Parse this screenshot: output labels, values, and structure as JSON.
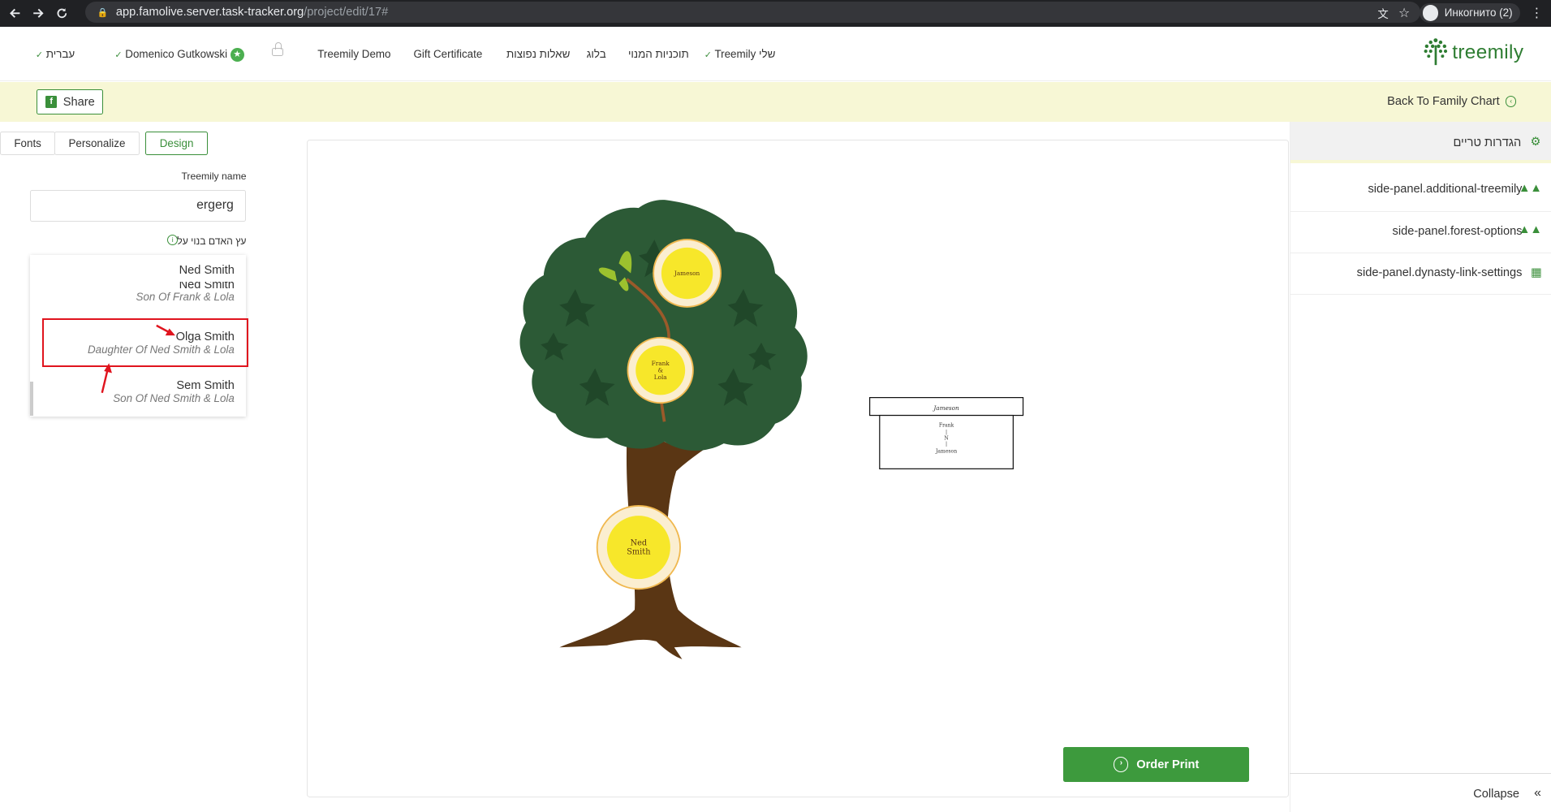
{
  "browser": {
    "url_host": "app.famolive.server.task-tracker.org",
    "url_path": "/project/edit/17#",
    "profile": "Инкогнито (2)"
  },
  "header": {
    "language": "עברית",
    "user": "Domenico Gutkowski",
    "nav": [
      "Treemily Demo",
      "Gift Certificate",
      "שאלות נפוצות",
      "בלוג",
      "תוכניות המנוי",
      "Treemily שלי"
    ],
    "logo": "treemily"
  },
  "toolbar": {
    "share": "Share",
    "back": "Back To Family Chart"
  },
  "left_panel": {
    "tabs": [
      "Fonts",
      "Personalize",
      "Design"
    ],
    "name_label": "Treemily name",
    "name_value": "ergerg",
    "person_label": "עץ האדם בנוי על",
    "selected": "Ned Smith",
    "options": [
      {
        "name": "Ned Smith",
        "sub": "Son Of Frank & Lola"
      },
      {
        "name": "Olga Smith",
        "sub": "Daughter Of Ned Smith & Lola"
      },
      {
        "name": "Sem Smith",
        "sub": "Son Of Ned Smith & Lola"
      }
    ]
  },
  "canvas": {
    "nodes": {
      "top": "Jameson",
      "mid_line1": "Frank",
      "mid_line2": "&",
      "mid_line3": "Lola",
      "bottom_line1": "Ned",
      "bottom_line2": "Smith"
    },
    "mini_box": {
      "title": "Jameson",
      "line1": "Frank",
      "line2": "|",
      "line3": "N",
      "line4": "|",
      "line5": "Jameson"
    },
    "order": "Order Print"
  },
  "right_panel": {
    "header": "הגדרות טריים",
    "items": [
      "side-panel.additional-treemily",
      "side-panel.forest-options",
      "side-panel.dynasty-link-settings"
    ],
    "collapse": "Collapse"
  },
  "colors": {
    "brand_green": "#3d9a3d",
    "banner": "#f7f7d5",
    "highlight": "#e0141e",
    "node_yellow": "#f7e72a"
  }
}
